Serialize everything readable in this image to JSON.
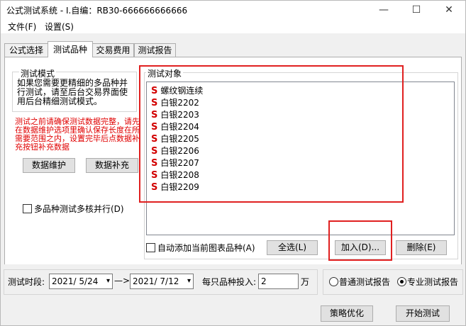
{
  "window": {
    "title": "公式测试系统 - I.自编：RB30-666666666666",
    "minimize": "—",
    "maximize": "☐",
    "close": "✕"
  },
  "menu": {
    "items": [
      "文件(F)",
      "设置(S)"
    ]
  },
  "tabs": [
    "公式选择",
    "测试品种",
    "交易费用",
    "测试报告"
  ],
  "active_tab": "测试品种",
  "test_mode": {
    "group_label": "测试模式",
    "description": "如果您需要更精细的多品种并行测试，请至后台交易界面使用后台精细测试模式。"
  },
  "warning": {
    "text": "测试之前请确保测试数据完整，请先在数据维护选项里确认保存长度在所需要范围之内，设置完毕后点数据补充按钮补充数据"
  },
  "buttons": {
    "data_maintain": "数据维护",
    "data_supplement": "数据补充",
    "select_all": "全选(L)",
    "add": "加入(D)...",
    "delete": "删除(E)",
    "optimize": "策略优化",
    "start_test": "开始测试"
  },
  "multicore": {
    "label": "多品种测试多核并行(D)",
    "checked": false
  },
  "test_objects": {
    "group_label": "测试对象",
    "items": [
      "螺纹钢连续",
      "白银2202",
      "白银2203",
      "白银2204",
      "白银2205",
      "白银2206",
      "白银2207",
      "白银2208",
      "白银2209"
    ],
    "marker": "S"
  },
  "auto_add": {
    "label": "自动添加当前图表品种(A)",
    "checked": false
  },
  "period": {
    "label": "测试时段:",
    "start": "2021/ 5/24",
    "arrow": "—>",
    "end": "2021/ 7/12"
  },
  "investment": {
    "label": "每只品种投入:",
    "value": "2",
    "unit": "万"
  },
  "report": {
    "normal": "普通测试报告",
    "pro": "专业测试报告",
    "selected": "专业测试报告"
  },
  "colors": {
    "highlight": "#e02020",
    "warning_text": "#e00000",
    "marker": "#d20000"
  }
}
